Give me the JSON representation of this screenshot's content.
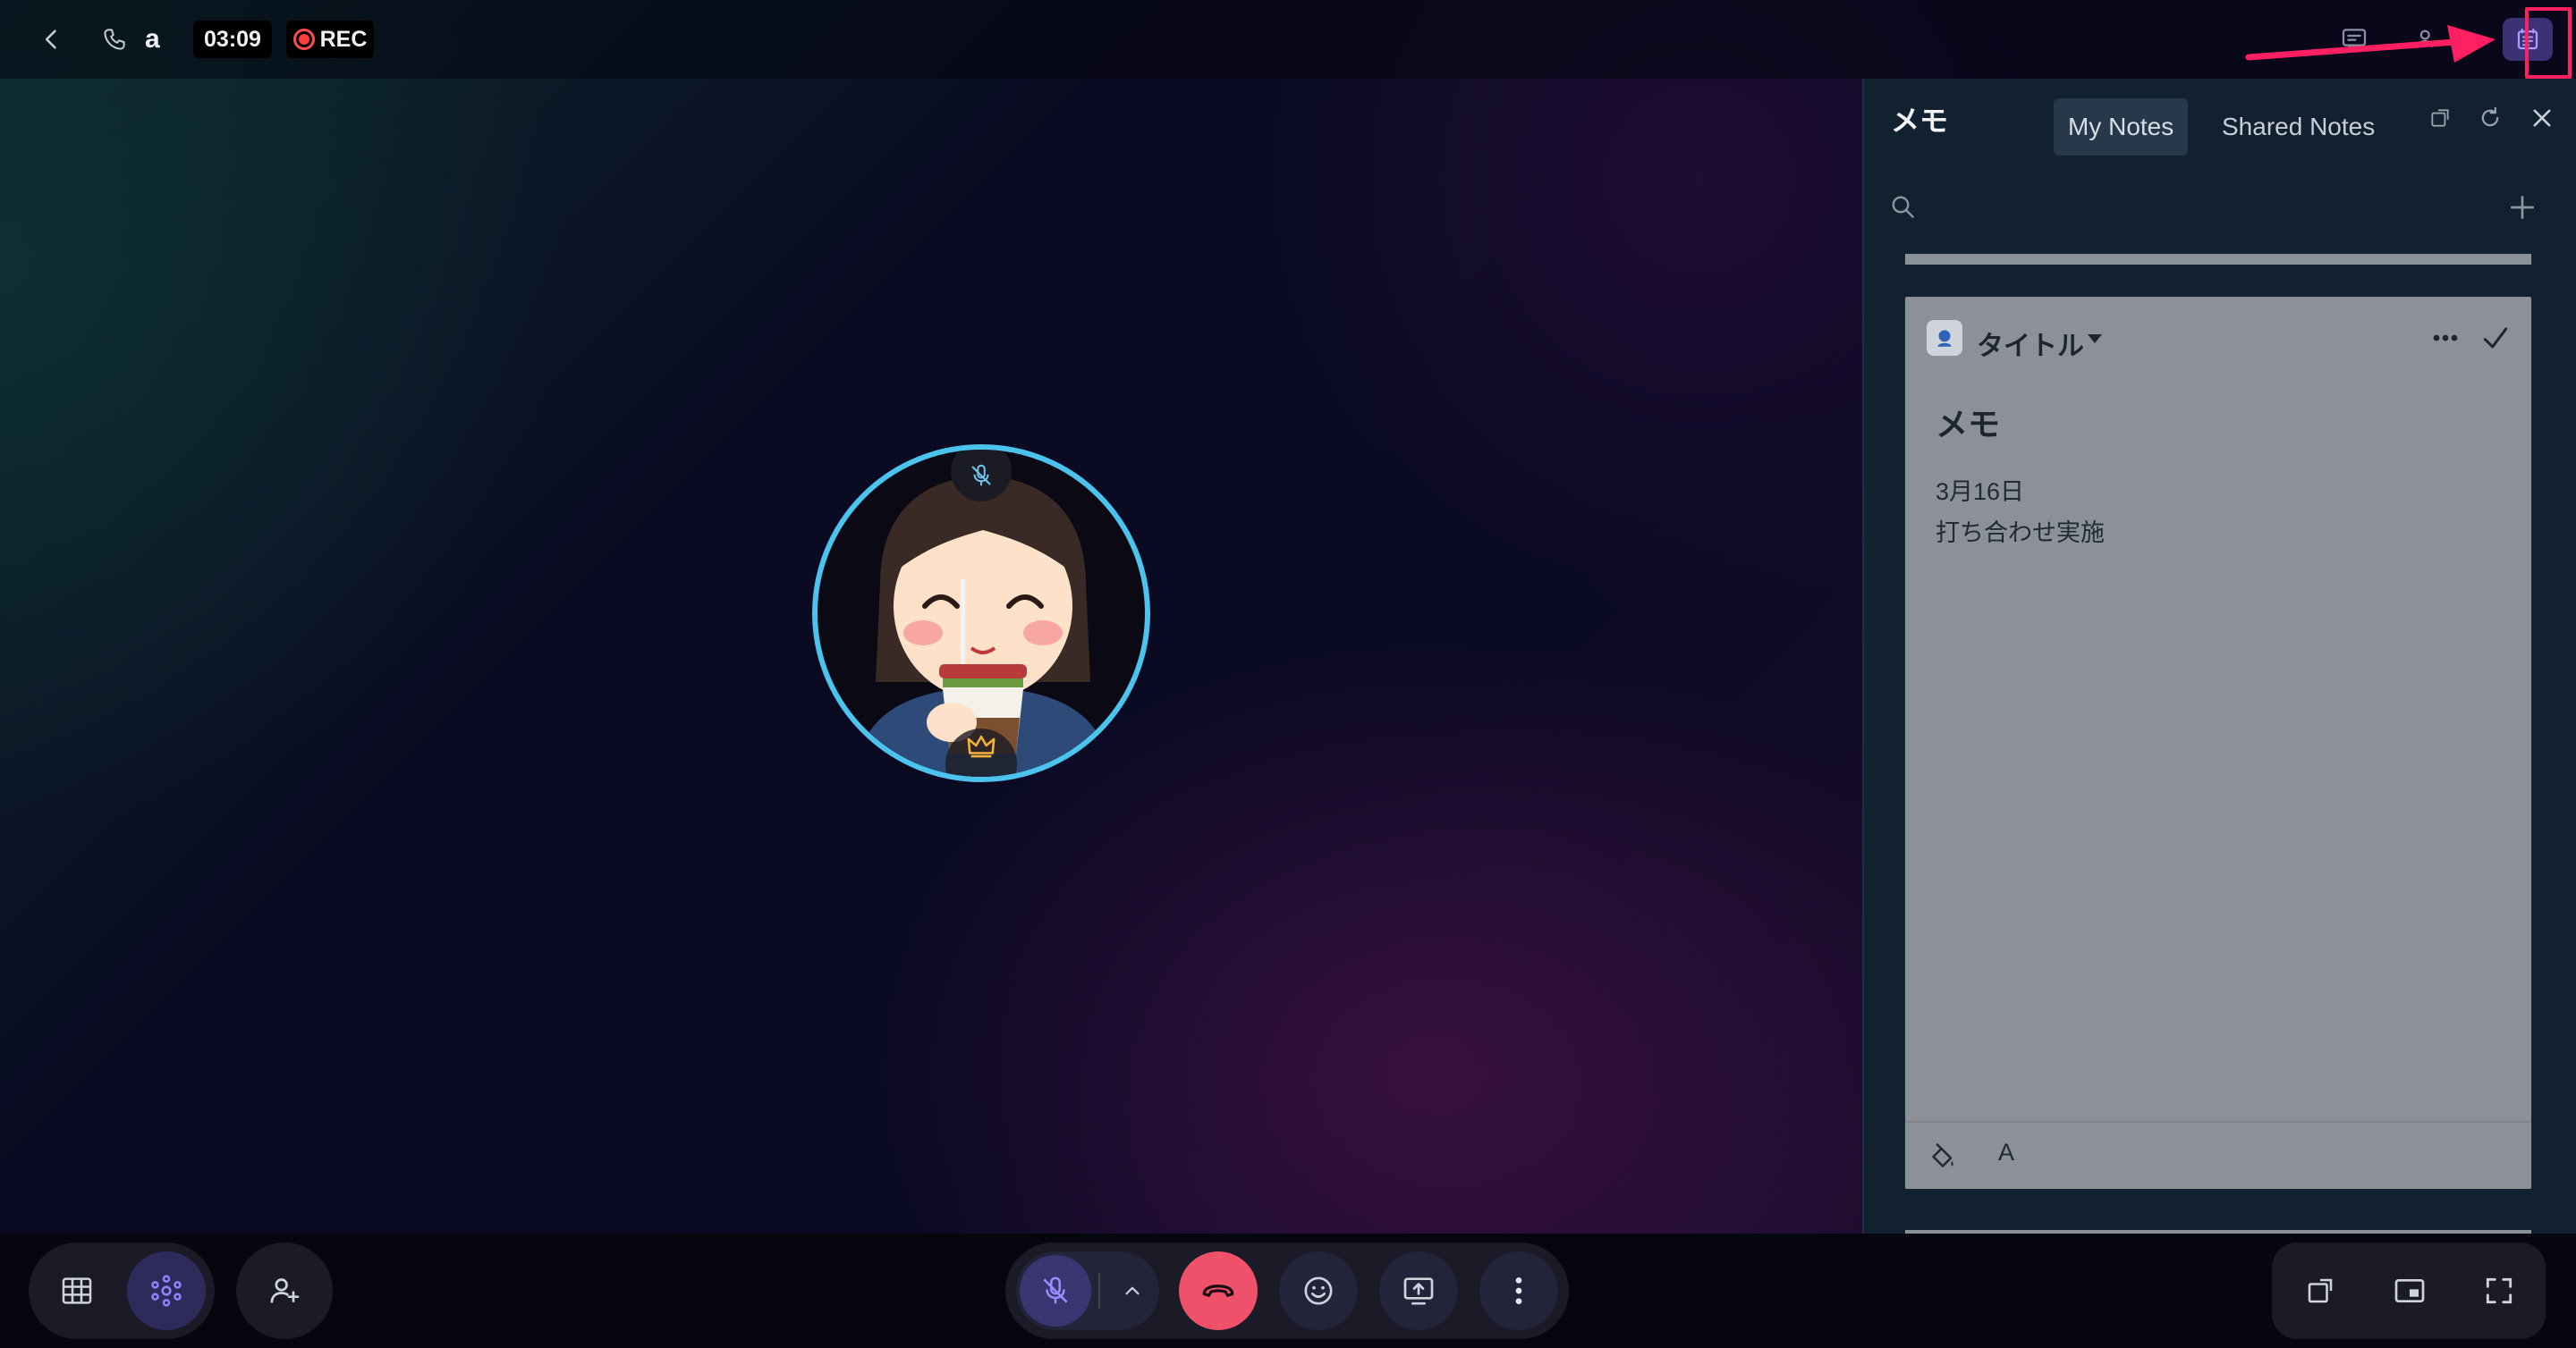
{
  "header": {
    "call_name": "a",
    "timer": "03:09",
    "rec_label": "REC",
    "participant_count": "1",
    "icons": [
      "chevron-left-icon",
      "phone-icon",
      "chat-icon",
      "people-icon",
      "notes-icon"
    ]
  },
  "notes_panel": {
    "title": "メモ",
    "tabs": [
      {
        "label": "My Notes",
        "active": true
      },
      {
        "label": "Shared Notes",
        "active": false
      }
    ],
    "note": {
      "title_label": "タイトル",
      "heading": "メモ",
      "lines": [
        "3月16日",
        "打ち合わせ実施"
      ],
      "font_button": "A"
    }
  },
  "colors": {
    "accent": "#4cc3ec",
    "highlight": "#ff1f63",
    "end_call": "#f0516a",
    "active_button": "#3b3275"
  }
}
